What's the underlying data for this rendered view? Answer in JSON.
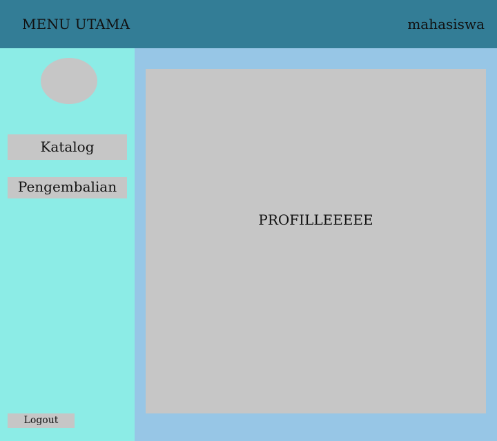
{
  "header": {
    "title": "MENU UTAMA",
    "user": "mahasiswa"
  },
  "sidebar": {
    "items": [
      {
        "label": "Katalog"
      },
      {
        "label": "Pengembalian"
      }
    ],
    "logout_label": "Logout"
  },
  "main": {
    "profile_text": "PROFILLEEEEE"
  },
  "colors": {
    "header_bg": "#337d96",
    "sidebar_bg": "#8cece6",
    "main_bg": "#97c6e6",
    "panel_bg": "#c6c6c6"
  }
}
